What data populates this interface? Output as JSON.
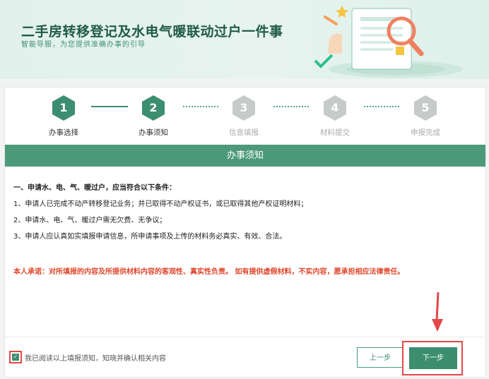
{
  "banner": {
    "title": "二手房转移登记及水电气暖联动过户一件事",
    "subtitle": "智能导服，为您提供准确办事的引导"
  },
  "steps": [
    {
      "number": "1",
      "label": "办事选择",
      "state": "done"
    },
    {
      "number": "2",
      "label": "办事须知",
      "state": "current"
    },
    {
      "number": "3",
      "label": "信息填报",
      "state": "pending"
    },
    {
      "number": "4",
      "label": "材料提交",
      "state": "pending"
    },
    {
      "number": "5",
      "label": "申报完成",
      "state": "pending"
    }
  ],
  "section": {
    "title": "办事须知"
  },
  "notes": {
    "heading": "一、申请水、电、气、暖过户，应当符合以下条件：",
    "lines": [
      "1、申请人已完成不动产转移登记业务；并已取得不动产权证书，或已取得其他产权证明材料；",
      "2、申请水、电、气、暖过户需无欠费、无争议；",
      "3、申请人应认真如实填报申请信息，所申请事项及上传的材料务必真实、有效、合法。"
    ],
    "promise": "本人承诺：对所填报的内容及所提供材料内容的客观性、真实性负责。 如有提供虚假材料，不实内容，愿承担相应法律责任。"
  },
  "footer": {
    "agree_label": "我已阅读以上填报须知，知晓并确认相关内容",
    "agree_checked": true,
    "prev_label": "上一步",
    "next_label": "下一步"
  },
  "colors": {
    "primary": "#3c8e70",
    "section_bar": "#4d9a7b",
    "warning_text": "#e0462b",
    "highlight": "#e24848"
  }
}
